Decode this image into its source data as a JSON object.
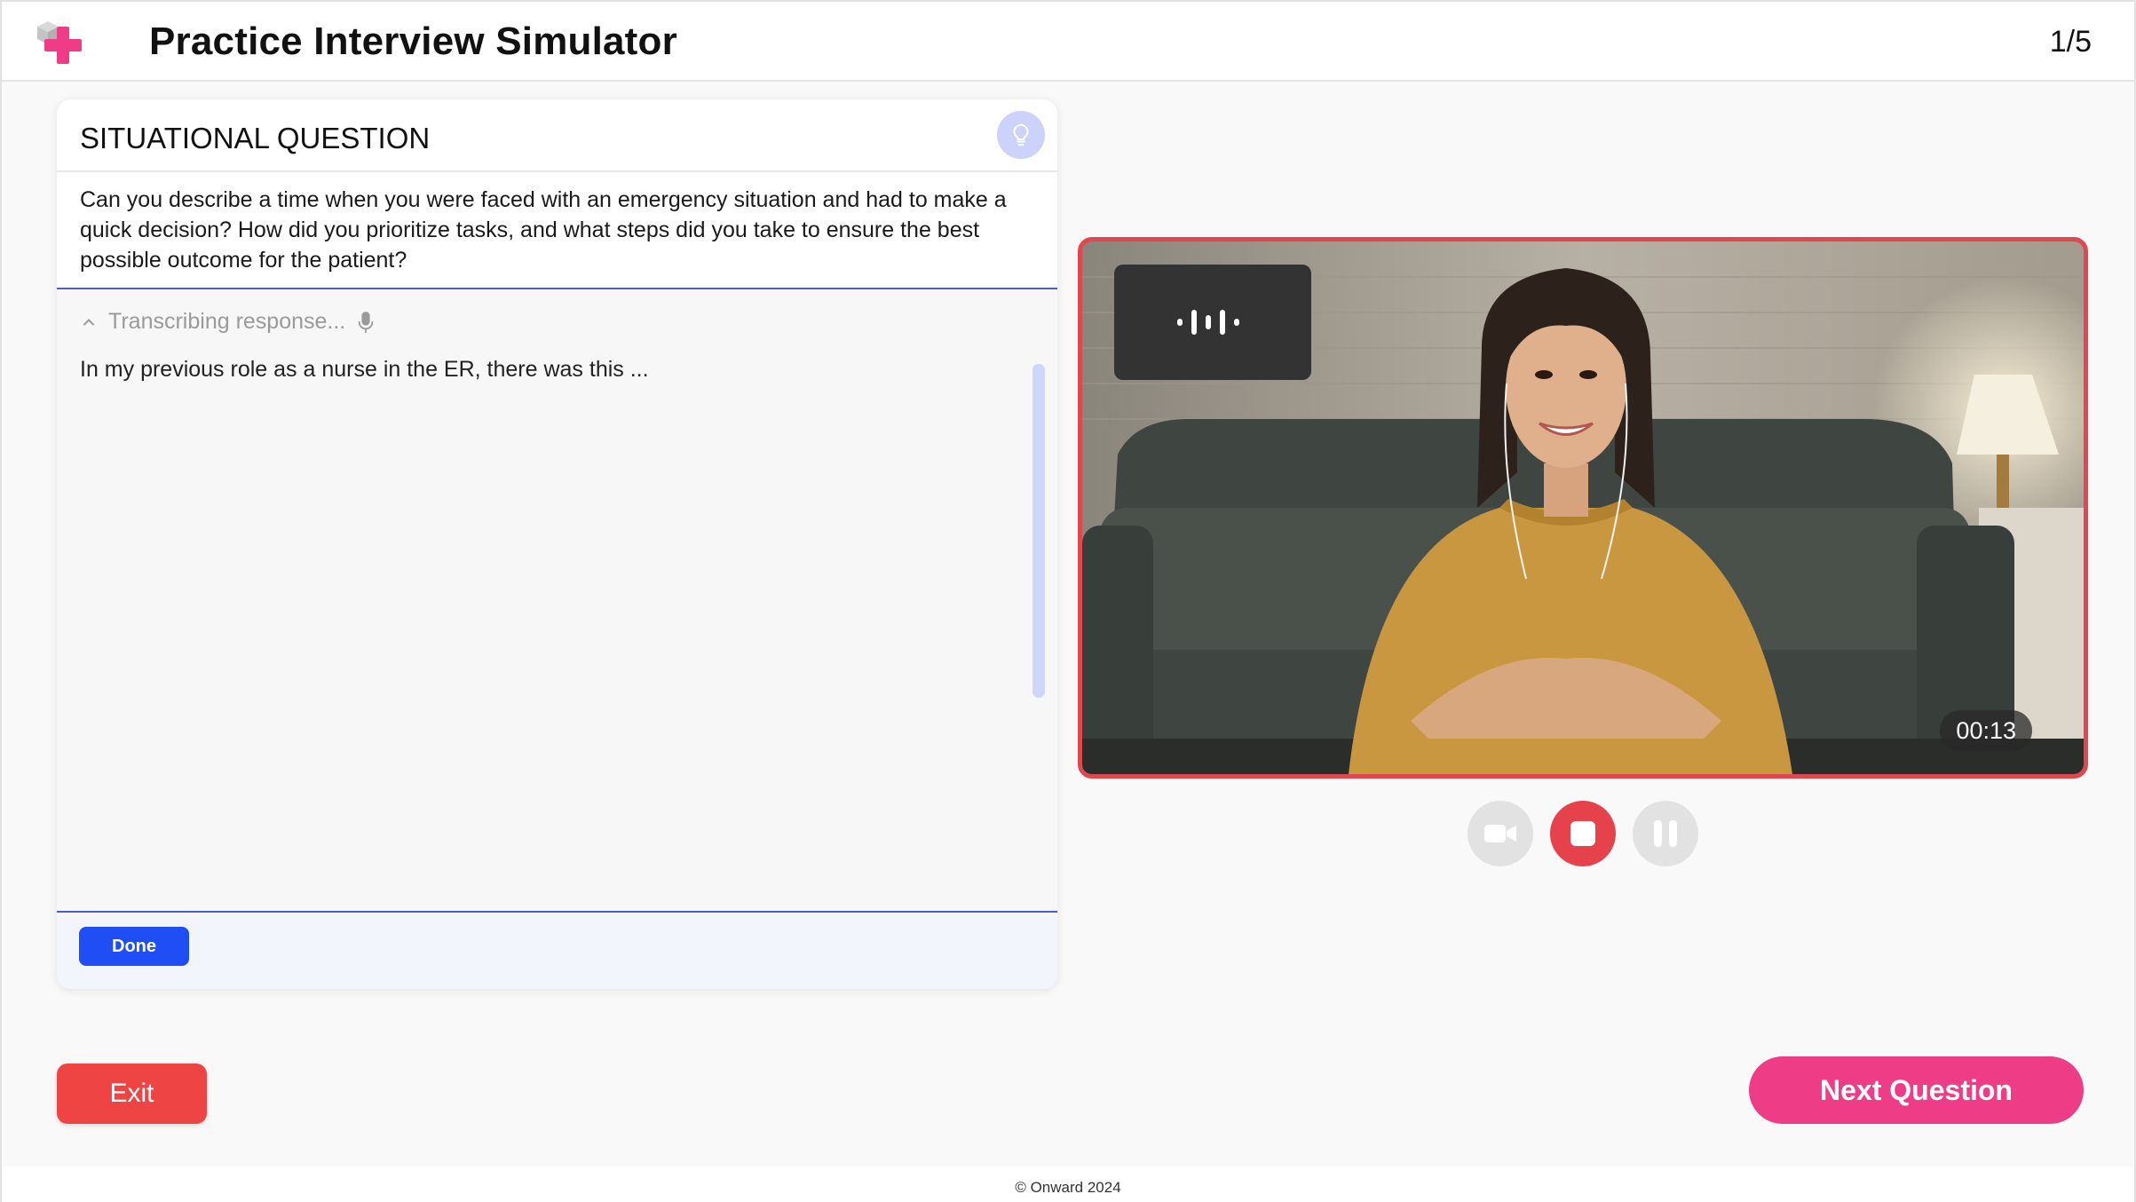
{
  "header": {
    "title": "Practice Interview Simulator",
    "progress": "1/5"
  },
  "question_card": {
    "category": "SITUATIONAL QUESTION",
    "question": "Can you describe a time when you were faced with an emergency situation and had to make a quick decision? How did you prioritize tasks, and what steps did you take to ensure the best possible outcome for the patient?",
    "status": "Transcribing response...",
    "answer": "In my previous role as a nurse in the ER, there was this ...",
    "done_label": "Done"
  },
  "video": {
    "timer": "00:13",
    "state": "recording",
    "controls": [
      "camera-icon",
      "stop-icon",
      "pause-icon"
    ]
  },
  "actions": {
    "exit_label": "Exit",
    "next_label": "Next Question"
  },
  "footer": {
    "copyright": "© Onward 2024"
  },
  "colors": {
    "accent_pink": "#ee3d86",
    "danger_red": "#ef4444",
    "primary_blue": "#1f4ef5",
    "hint_lavender": "#cdd2fb"
  }
}
